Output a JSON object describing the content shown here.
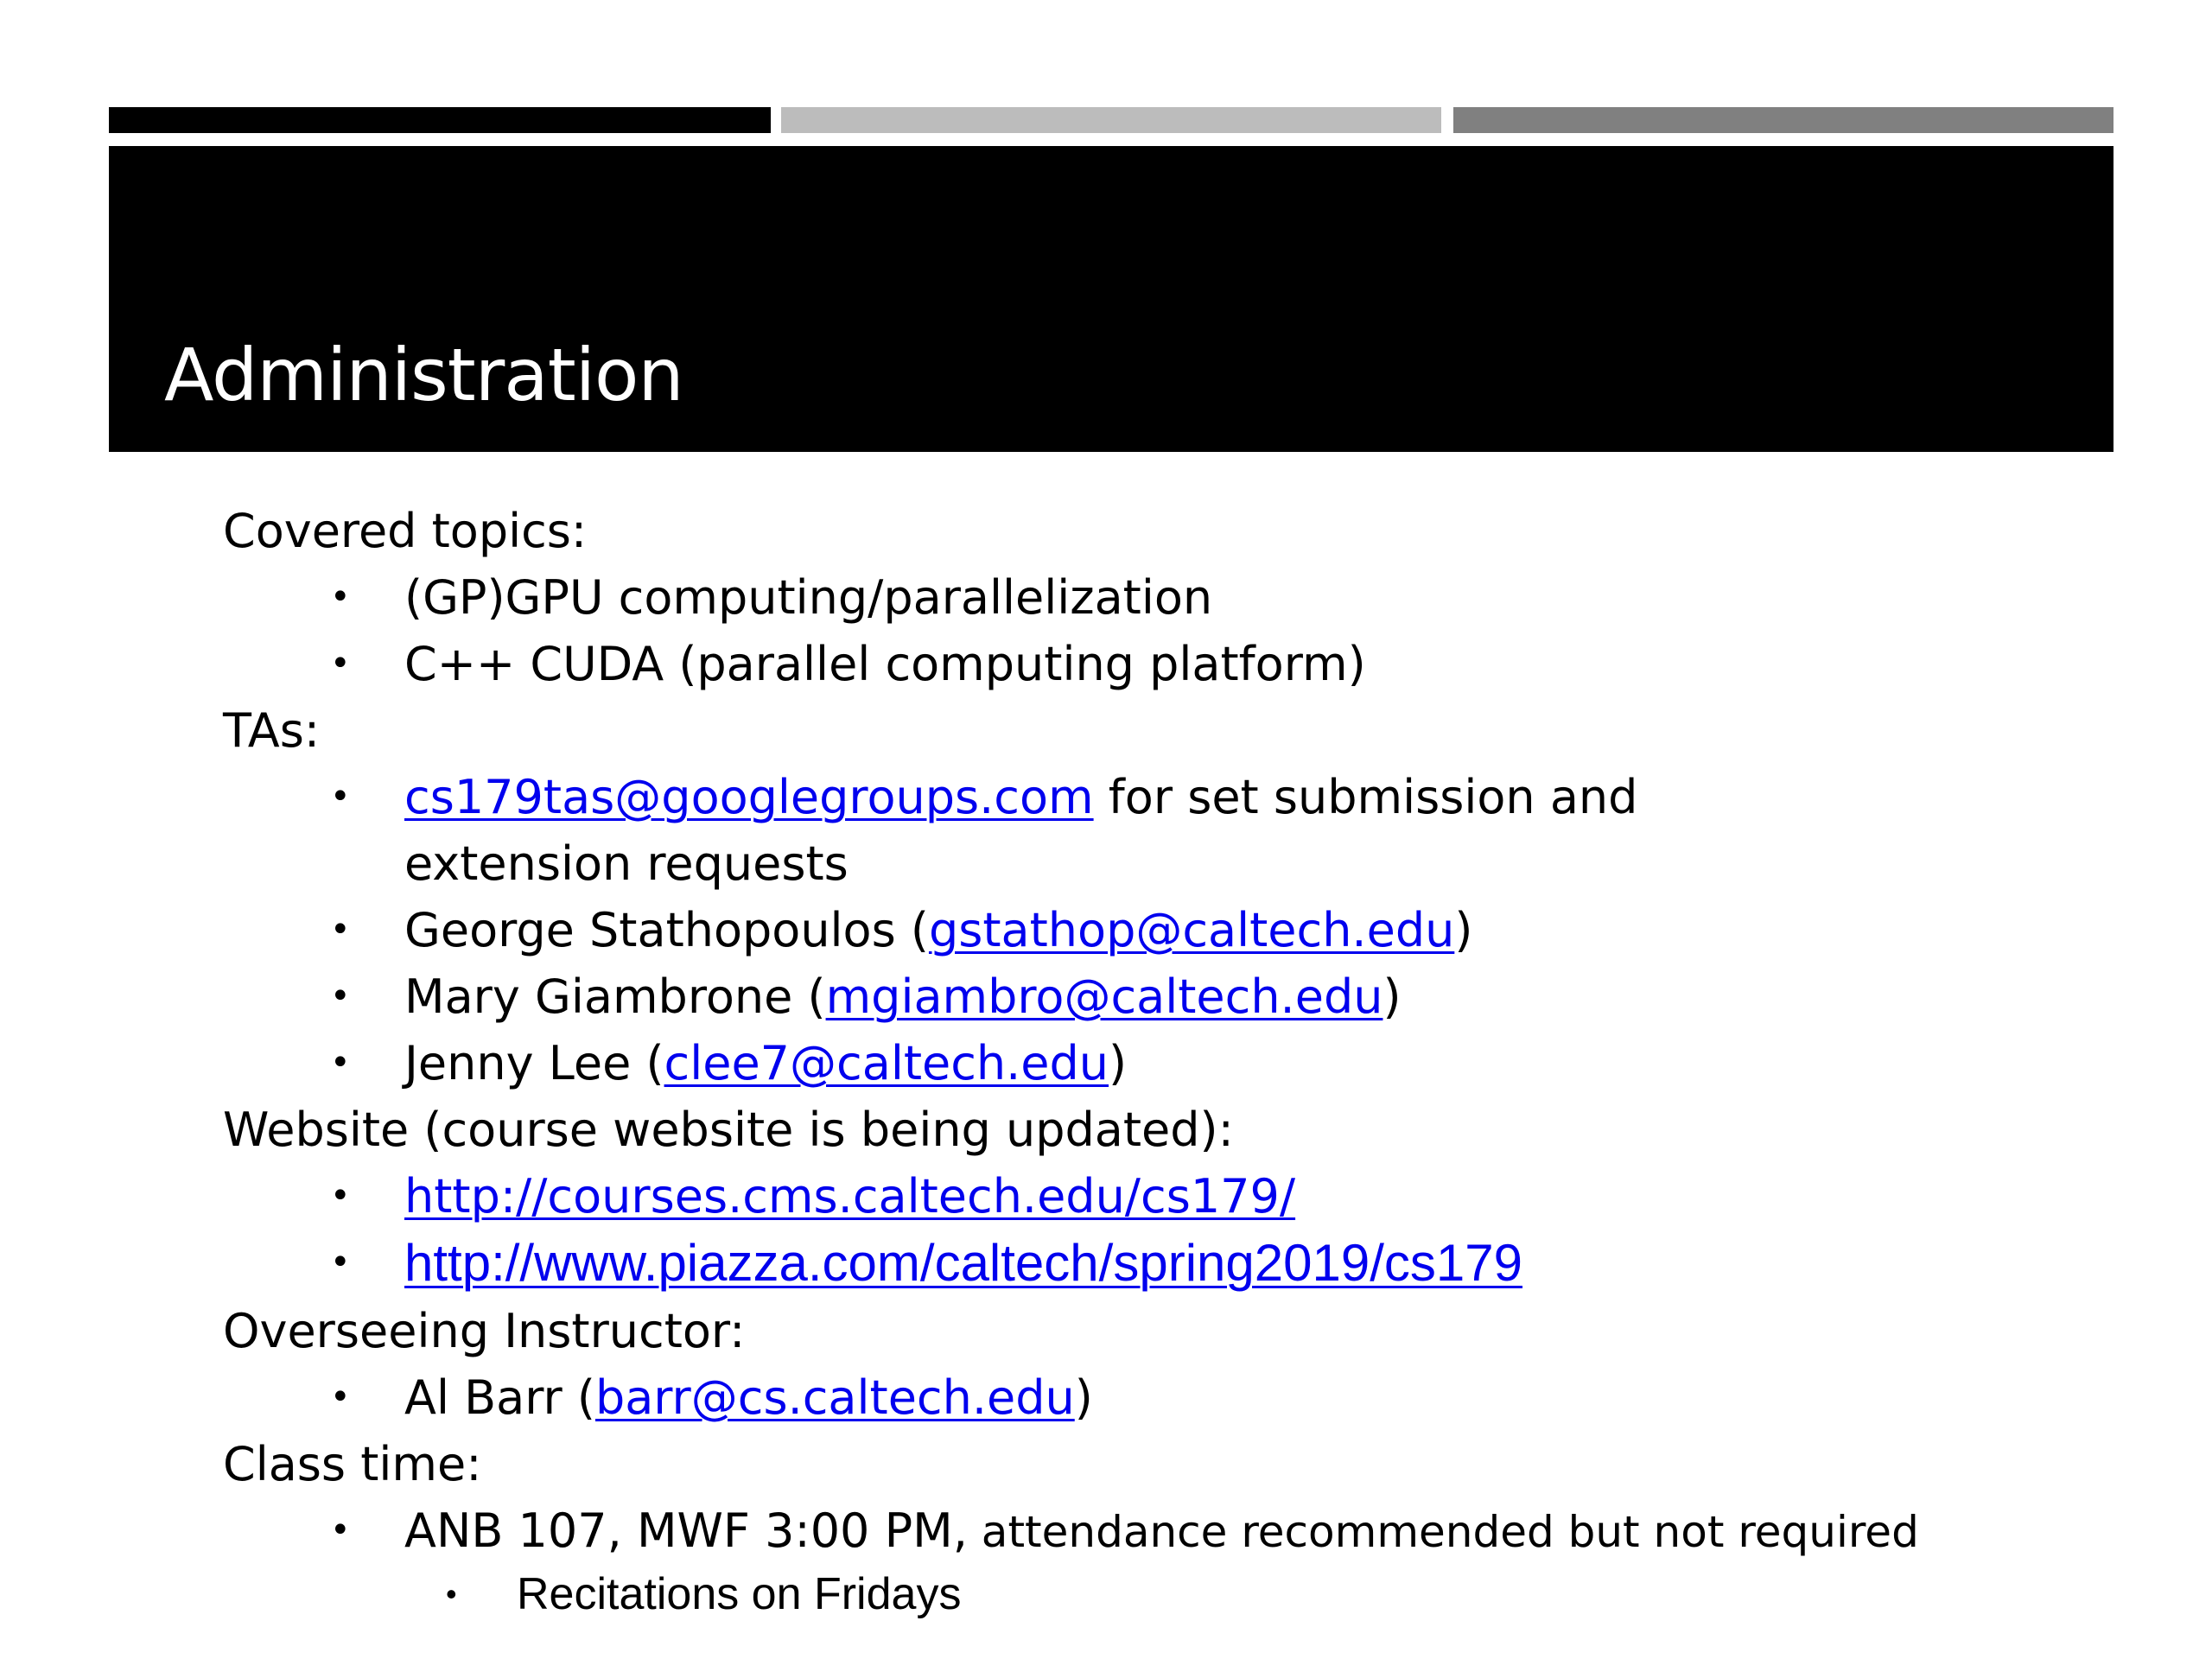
{
  "slide": {
    "title": "Administration",
    "accent_bars": [
      "#000000",
      "#bcbcbc",
      "#808080"
    ]
  },
  "sections": {
    "topics": {
      "heading": "Covered topics:",
      "items": [
        "(GP)GPU computing/parallelization",
        "C++ CUDA (parallel computing platform)"
      ]
    },
    "tas": {
      "heading": "TAs:",
      "group_email": "cs179tas@googlegroups.com",
      "group_email_desc": " for set submission and extension requests",
      "people": [
        {
          "name": "George Stathopoulos (",
          "email": "gstathop@caltech.edu",
          "close": ")"
        },
        {
          "name": "Mary Giambrone (",
          "email": "mgiambro@caltech.edu",
          "close": ")"
        },
        {
          "name": "Jenny Lee (",
          "email": "clee7@caltech.edu",
          "close": ")"
        }
      ]
    },
    "website": {
      "heading": "Website (course website is being updated):",
      "links": [
        "http://courses.cms.caltech.edu/cs179/",
        "http://www.piazza.com/caltech/spring2019/cs179"
      ]
    },
    "instructor": {
      "heading": "Overseeing Instructor:",
      "name": "Al Barr (",
      "email": "barr@cs.caltech.edu",
      "close": ")"
    },
    "class_time": {
      "heading": "Class time:",
      "main_lead": "ANB 107, MWF 3:00 PM,",
      "main_tail": " attendance recommended but not required",
      "sub_item": "Recitations on Fridays"
    }
  },
  "bullet_glyph": "•",
  "colors": {
    "link": "#0000ee",
    "title_band": "#000000",
    "title_text": "#ffffff"
  }
}
